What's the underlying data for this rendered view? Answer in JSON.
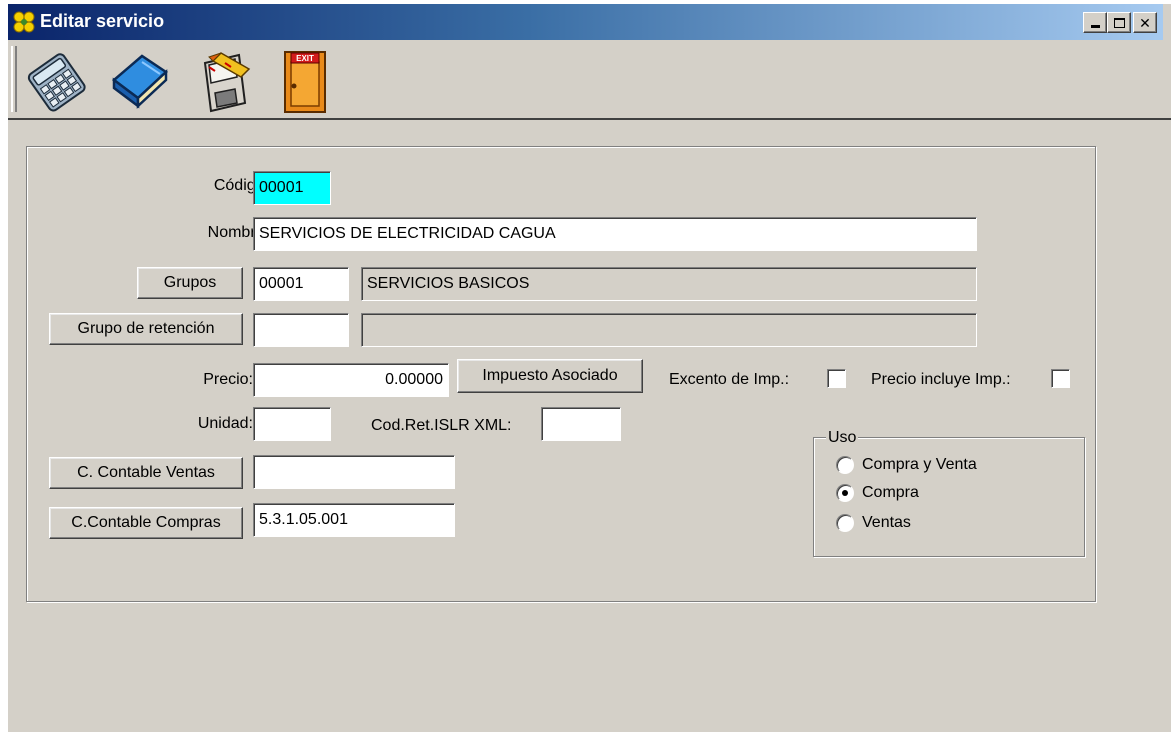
{
  "window": {
    "title": "Editar servicio",
    "controls": {
      "minimize": "_",
      "maximize": "□",
      "close": "✕"
    }
  },
  "toolbar": {
    "items": [
      {
        "name": "calculator-icon"
      },
      {
        "name": "book-icon"
      },
      {
        "name": "save-disk-icon"
      },
      {
        "name": "exit-door-icon",
        "text": "EXIT"
      }
    ]
  },
  "form": {
    "codigo_label": "Código:",
    "codigo_value": "00001",
    "nombre_label": "Nombre:",
    "nombre_value": "SERVICIOS DE ELECTRICIDAD  CAGUA",
    "grupos_button": "Grupos",
    "grupos_code": "00001",
    "grupos_desc": "SERVICIOS BASICOS",
    "retencion_button": "Grupo de retención",
    "retencion_code": "",
    "retencion_desc": "",
    "precio_label": "Precio:",
    "precio_value": "0.00000",
    "impuesto_button": "Impuesto Asociado",
    "excento_label": "Excento de Imp.:",
    "precio_incluye_label": "Precio incluye Imp.:",
    "unidad_label": "Unidad:",
    "unidad_value": "",
    "codret_label": "Cod.Ret.ISLR XML:",
    "codret_value": "",
    "cventas_button": "C. Contable Ventas",
    "cventas_value": "",
    "ccompras_button": "C.Contable Compras",
    "ccompras_value": "5.3.1.05.001"
  },
  "uso": {
    "legend": "Uso",
    "options": [
      "Compra y  Venta",
      "Compra",
      "Ventas"
    ],
    "selected": "Compra"
  },
  "colors": {
    "titlebar_start": "#0a246a",
    "titlebar_end": "#a6caf0",
    "face": "#d4d0c8",
    "highlight_field": "#00ffff"
  }
}
